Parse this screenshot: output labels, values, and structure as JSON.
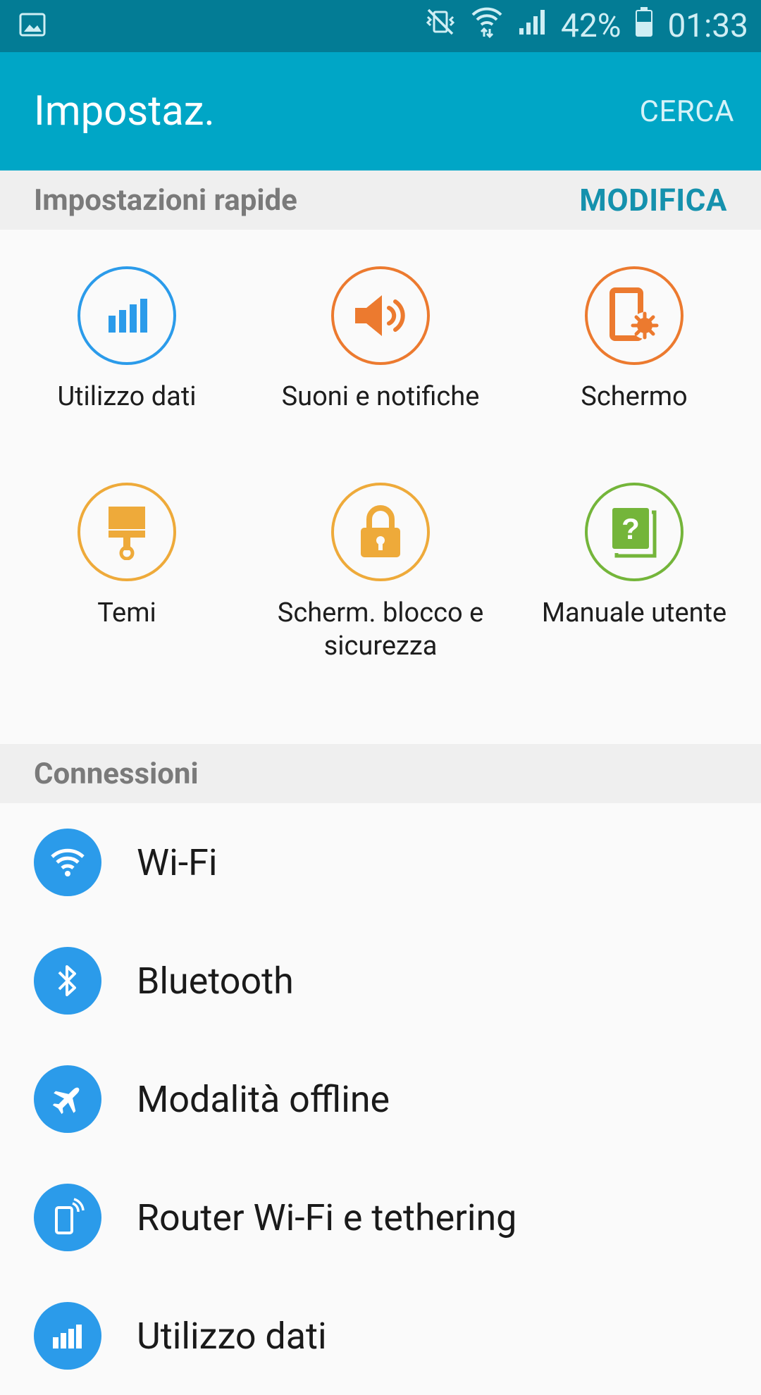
{
  "status_bar": {
    "battery_percent": "42%",
    "time": "01:33"
  },
  "app_bar": {
    "title": "Impostaz.",
    "action_label": "CERCA"
  },
  "quick_settings": {
    "header_title": "Impostazioni rapide",
    "edit_label": "MODIFICA",
    "items": [
      {
        "label": "Utilizzo dati",
        "icon": "data-usage-icon",
        "color": "#2b9bea"
      },
      {
        "label": "Suoni e notifiche",
        "icon": "speaker-icon",
        "color": "#ec7a2f"
      },
      {
        "label": "Schermo",
        "icon": "display-brightness-icon",
        "color": "#ec7a2f"
      },
      {
        "label": "Temi",
        "icon": "paint-brush-icon",
        "color": "#eeaa3a"
      },
      {
        "label": "Scherm. blocco e sicurezza",
        "icon": "lock-icon",
        "color": "#eeaa3a"
      },
      {
        "label": "Manuale utente",
        "icon": "help-book-icon",
        "color": "#74b53a"
      }
    ]
  },
  "connections": {
    "header_title": "Connessioni",
    "items": [
      {
        "label": "Wi-Fi",
        "icon": "wifi-icon"
      },
      {
        "label": "Bluetooth",
        "icon": "bluetooth-icon"
      },
      {
        "label": "Modalità offline",
        "icon": "airplane-icon"
      },
      {
        "label": "Router Wi-Fi e tethering",
        "icon": "hotspot-icon"
      },
      {
        "label": "Utilizzo dati",
        "icon": "data-usage-icon"
      }
    ]
  },
  "colors": {
    "status_bar": "#037c95",
    "app_bar": "#00a6c6",
    "accent": "#1591ad",
    "list_icon_bg": "#2b9bea"
  }
}
